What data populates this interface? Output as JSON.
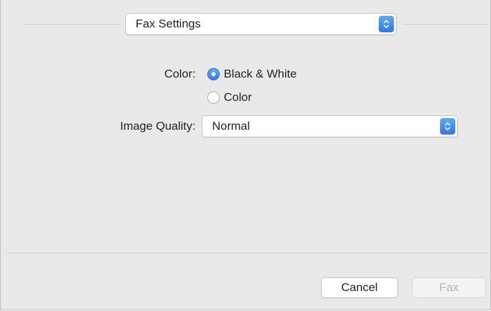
{
  "pane_selector": {
    "value": "Fax Settings"
  },
  "color": {
    "label": "Color:",
    "options": [
      {
        "label": "Black & White",
        "selected": true
      },
      {
        "label": "Color",
        "selected": false
      }
    ]
  },
  "image_quality": {
    "label": "Image Quality:",
    "value": "Normal"
  },
  "buttons": {
    "cancel": "Cancel",
    "fax": "Fax"
  },
  "colors": {
    "accent": "#2c7cf0",
    "background": "#e9e9e9"
  }
}
